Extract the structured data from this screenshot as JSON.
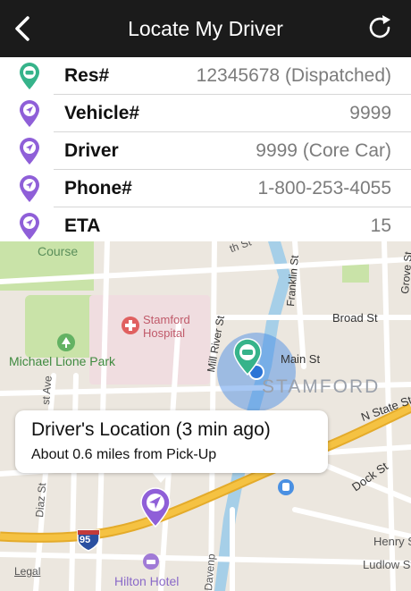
{
  "nav": {
    "title": "Locate My Driver",
    "back_icon": "chevron-left-icon",
    "refresh_icon": "refresh-icon",
    "bar_color": "#1b1b1b"
  },
  "info_rows": [
    {
      "label": "Res#",
      "value": "12345678 (Dispatched)",
      "icon": "car-pin-green-icon"
    },
    {
      "label": "Vehicle#",
      "value": "9999",
      "icon": "location-pin-purple-icon"
    },
    {
      "label": "Driver",
      "value": "9999 (Core Car)",
      "icon": "location-pin-purple-icon"
    },
    {
      "label": "Phone#",
      "value": "1-800-253-4055",
      "icon": "location-pin-purple-icon"
    },
    {
      "label": "ETA",
      "value": "15",
      "icon": "location-pin-purple-icon"
    }
  ],
  "map": {
    "labels": {
      "course": "Course",
      "hospital": "Stamford Hospital",
      "hospital_line1": "Stamford",
      "hospital_line2": "Hospital",
      "park": "Michael Lione Park",
      "stamford": "STAMFORD",
      "broad_st": "Broad St",
      "main_st": "Main St",
      "mill_river_st": "Mill River St",
      "franklin_st": "Franklin St",
      "grove_st": "Grove St",
      "n_state_st": "N State St",
      "dock_st": "Dock St",
      "henry_st": "Henry St",
      "ludlow_st": "Ludlow St",
      "west_ave": "st Ave",
      "diaz_st": "Diaz St",
      "davenport": "Davenp",
      "hilton": "Hilton Hotel",
      "fifth_st": "th St",
      "highway": "95",
      "legal": "Legal"
    },
    "callout": {
      "title": "Driver's Location (3 min ago)",
      "subtitle": "About 0.6 miles from Pick-Up"
    },
    "colors": {
      "highway": "#f5c242",
      "park": "#c9e3a8",
      "water": "#a6cfe8",
      "pin_purple": "#8f5fd8",
      "pin_green": "#36b38a",
      "accuracy_circle": "#3d86e6"
    }
  }
}
